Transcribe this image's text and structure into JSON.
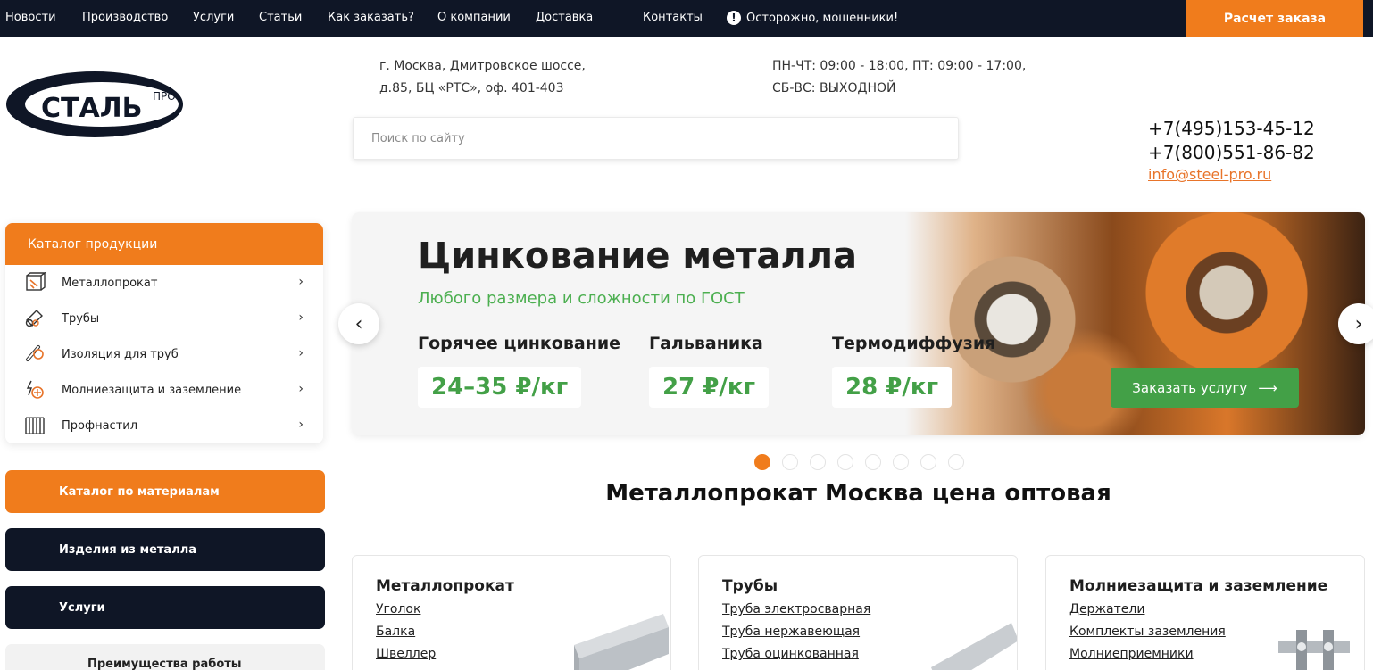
{
  "nav": {
    "items": [
      "Новости",
      "Производство",
      "Услуги",
      "Статьи",
      "Как заказать?",
      "О компании",
      "Доставка",
      "Контакты"
    ],
    "warning": "Осторожно, мошенники!",
    "calc_button": "Расчет заказа"
  },
  "logo": {
    "main_text": "СТАЛЬ",
    "sup_text": "ПРО"
  },
  "header": {
    "address_line1": "г. Москва, Дмитровское шоссе,",
    "address_line2": "д.85, БЦ «РТС», оф. 401-403",
    "hours_line1": "ПН-ЧТ: 09:00 - 18:00, ПТ: 09:00 - 17:00,",
    "hours_line2": "СБ-ВС: ВЫХОДНОЙ",
    "search_placeholder": "Поиск по сайту",
    "phone1": "+7(495)153-45-12",
    "phone2": "+7(800)551-86-82",
    "email": "info@steel-pro.ru"
  },
  "sidebar": {
    "catalog_title": "Каталог продукции",
    "items": [
      {
        "label": "Металлопрокат",
        "icon": "metal-icon"
      },
      {
        "label": "Трубы",
        "icon": "pipes-icon"
      },
      {
        "label": "Изоляция для труб",
        "icon": "insulation-icon"
      },
      {
        "label": "Молниезащита и заземление",
        "icon": "lightning-icon"
      },
      {
        "label": "Профнастил",
        "icon": "profnastil-icon"
      }
    ],
    "btn_materials": "Каталог по материалам",
    "btn_products": "Изделия из металла",
    "btn_services": "Услуги",
    "advantages": "Преимущества работы"
  },
  "banner": {
    "title": "Цинкование металла",
    "subtitle": "Любого размера и сложности по ГОСТ",
    "services": [
      {
        "label": "Горячее цинкование",
        "price": "24–35 ₽/кг"
      },
      {
        "label": "Гальваника",
        "price": "27 ₽/кг"
      },
      {
        "label": "Термодиффузия",
        "price": "28 ₽/кг"
      }
    ],
    "order_button": "Заказать услугу",
    "slide_count": 8,
    "active_slide": 1
  },
  "section": {
    "title": "Металлопрокат Москва цена оптовая"
  },
  "cards": [
    {
      "title": "Металлопрокат",
      "links": [
        "Уголок",
        "Балка",
        "Швеллер"
      ]
    },
    {
      "title": "Трубы",
      "links": [
        "Труба электросварная",
        "Труба нержавеющая",
        "Труба оцинкованная"
      ]
    },
    {
      "title": "Молниезащита и заземление",
      "links": [
        "Держатели",
        "Комплекты заземления",
        "Молниеприемники"
      ]
    }
  ],
  "colors": {
    "orange": "#f07c1c",
    "dark": "#0f1626",
    "green": "#43a047",
    "link": "#e8742a"
  }
}
